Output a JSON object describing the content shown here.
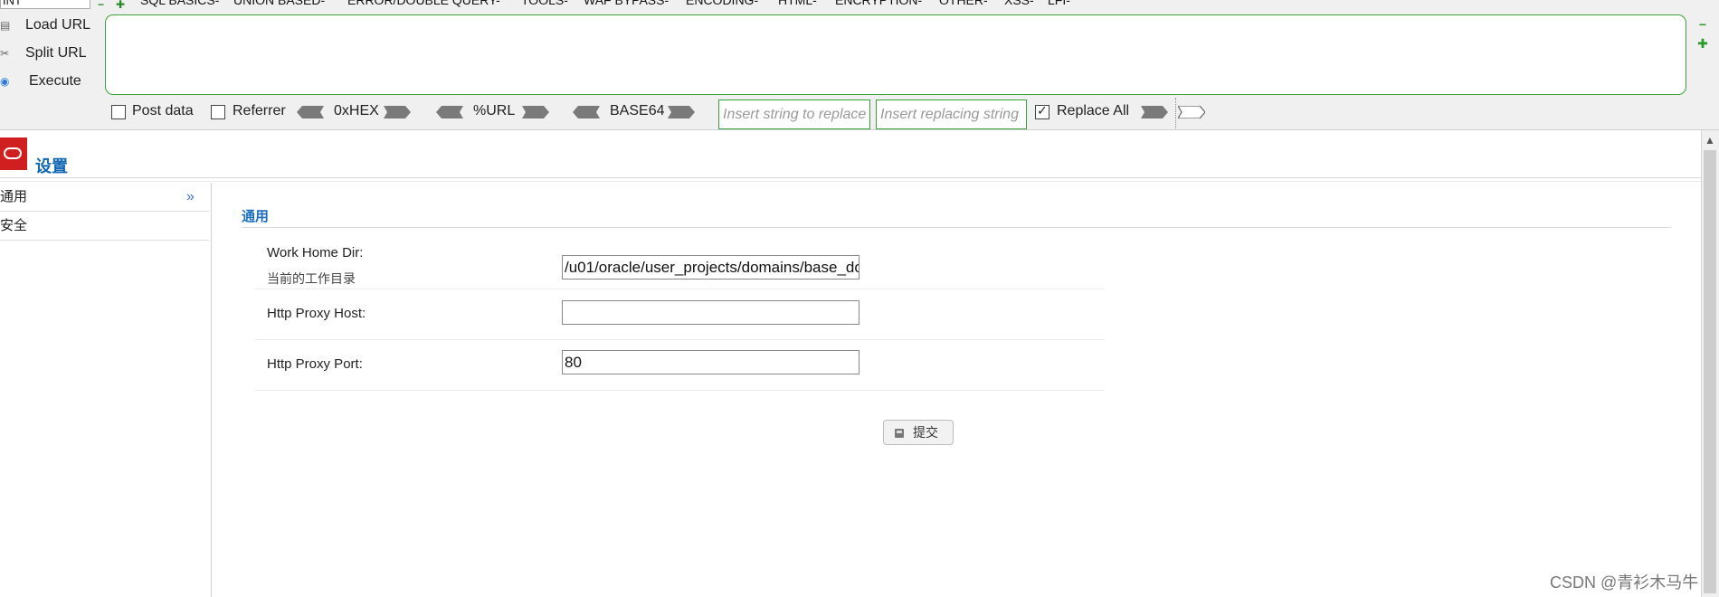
{
  "hackbar": {
    "selector_value": "INT",
    "menu": [
      "SQL BASICS-",
      "UNION BASED-",
      "ERROR/DOUBLE QUERY-",
      "TOOLS-",
      "WAF BYPASS-",
      "ENCODING-",
      "HTML-",
      "ENCRYPTION-",
      "OTHER-",
      "XSS-",
      "LFI-"
    ],
    "load_url": "Load URL",
    "split_url": "Split URL",
    "execute": "Execute",
    "url_value": "",
    "post_data": {
      "label": "Post data",
      "checked": false
    },
    "referrer": {
      "label": "Referrer",
      "checked": false
    },
    "hex_label": "0xHEX",
    "url_enc_label": "%URL",
    "base64_label": "BASE64",
    "replace_search_placeholder": "Insert string to replace",
    "replace_with_placeholder": "Insert replacing string",
    "replace_all": {
      "label": "Replace All",
      "checked": true
    }
  },
  "page": {
    "title": "设置",
    "sidebar": [
      {
        "label": "通用",
        "active": true
      },
      {
        "label": "安全",
        "active": false
      }
    ],
    "section_title": "通用",
    "fields": [
      {
        "label": "Work Home Dir:",
        "hint": "当前的工作目录",
        "value": "/u01/oracle/user_projects/domains/base_do"
      },
      {
        "label": "Http Proxy Host:",
        "hint": "",
        "value": ""
      },
      {
        "label": "Http Proxy Port:",
        "hint": "",
        "value": "80"
      }
    ],
    "submit_label": "提交"
  },
  "watermark": "CSDN @青衫木马牛",
  "colors": {
    "accent": "#1167b1",
    "hackbar_border": "#3aa23a",
    "logo": "#d01f1f"
  }
}
